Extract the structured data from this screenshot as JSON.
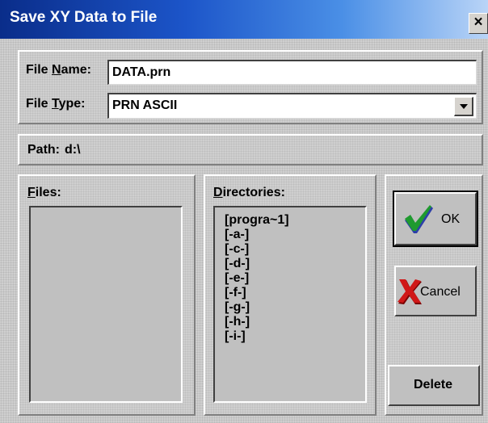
{
  "dialog": {
    "title": "Save XY Data to File",
    "close_glyph": "×"
  },
  "file_name": {
    "label_prefix": "File ",
    "label_accel": "N",
    "label_suffix": "ame:",
    "value": "DATA.prn"
  },
  "file_type": {
    "label_prefix": "File ",
    "label_accel": "T",
    "label_suffix": "ype:",
    "value": "PRN ASCII",
    "dropdown_icon": "chevron-down-icon"
  },
  "path": {
    "label": "Path:",
    "value": "d:\\"
  },
  "files": {
    "label_accel": "F",
    "label_rest": "iles:",
    "items": []
  },
  "directories": {
    "label_accel": "D",
    "label_rest": "irectories:",
    "items": [
      "[progra~1]",
      "[-a-]",
      "[-c-]",
      "[-d-]",
      "[-e-]",
      "[-f-]",
      "[-g-]",
      "[-h-]",
      "[-i-]"
    ]
  },
  "buttons": {
    "ok": "OK",
    "cancel": "Cancel",
    "delete": "Delete"
  },
  "colors": {
    "title_bar_start": "#0a2d8a",
    "title_bar_end": "#b9d4f7",
    "check_green": "#1f9a2f",
    "check_blue": "#2c3fa8",
    "cancel_red": "#d01818"
  }
}
